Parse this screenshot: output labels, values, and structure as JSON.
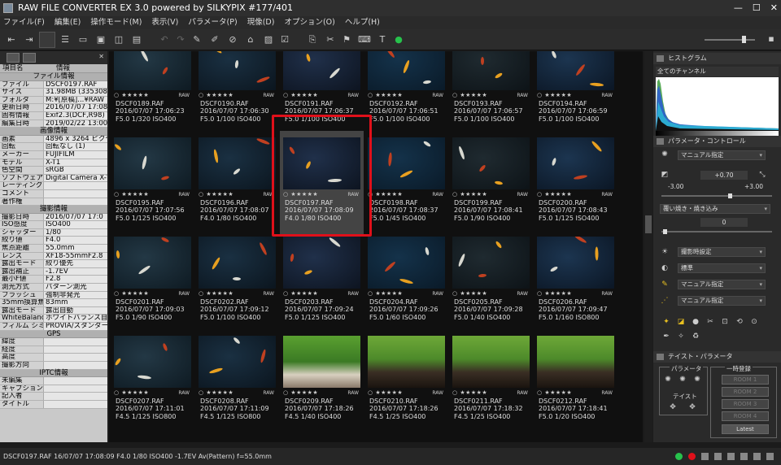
{
  "window": {
    "title": "RAW FILE CONVERTER EX 3.0 powered by SILKYPIX    #177/401"
  },
  "menu": [
    "ファイル(F)",
    "編集(E)",
    "操作モード(M)",
    "表示(V)",
    "パラメータ(P)",
    "現像(D)",
    "オプション(O)",
    "ヘルプ(H)"
  ],
  "left_panel": {
    "header": {
      "key": "項目名",
      "value": "情報"
    },
    "rows": [
      {
        "type": "section",
        "label": "ファイル情報"
      },
      {
        "k": "ファイル",
        "v": "DSCF0197.RAF"
      },
      {
        "k": "サイズ",
        "v": "31.98MB (3353088"
      },
      {
        "k": "フォルダ",
        "v": "M:¥[原稿]...¥RAW"
      },
      {
        "k": "更新日時",
        "v": "2016/07/07 17:08:"
      },
      {
        "k": "固有情報",
        "v": "Exif2.3(DCF,R98) Y"
      },
      {
        "k": "編集日時",
        "v": "2019/02/22 13:00:"
      },
      {
        "type": "section",
        "label": "画像情報"
      },
      {
        "k": "画素",
        "v": "4896 x 3264 ピクセル"
      },
      {
        "k": "回転",
        "v": "回転なし (1)"
      },
      {
        "k": "メーカー",
        "v": "FUJIFILM"
      },
      {
        "k": "モデル",
        "v": "X-T1"
      },
      {
        "k": "色空間",
        "v": "sRGB"
      },
      {
        "k": "ソフトウェア",
        "v": "Digital Camera X-T"
      },
      {
        "k": "レーティング",
        "v": ""
      },
      {
        "k": "コメント",
        "v": ""
      },
      {
        "k": "著作権",
        "v": ""
      },
      {
        "type": "section",
        "label": "撮影情報"
      },
      {
        "k": "撮影日時",
        "v": "2016/07/07 17:0"
      },
      {
        "k": "ISO感度",
        "v": "ISO400"
      },
      {
        "k": "シャッター",
        "v": "1/80"
      },
      {
        "k": "絞り値",
        "v": "F4.0"
      },
      {
        "k": "焦点距離",
        "v": "55.0mm"
      },
      {
        "k": "レンズ",
        "v": "XF18-55mmF2.8"
      },
      {
        "k": "露出モード",
        "v": "絞り優先"
      },
      {
        "k": "露出補正",
        "v": "-1.7EV"
      },
      {
        "k": "最小F値",
        "v": "F2.8"
      },
      {
        "k": "測光方式",
        "v": "パターン測光"
      },
      {
        "k": "フラッシュ",
        "v": "強制非発光"
      },
      {
        "k": "35mm換算焦点",
        "v": "83mm"
      },
      {
        "k": "露出モード",
        "v": "露出自動"
      },
      {
        "k": "WhiteBalance",
        "v": "ホワイトバランス自動"
      },
      {
        "k": "フィルム シミュ",
        "v": "PROVIA/スタンダード"
      },
      {
        "type": "section",
        "label": "GPS"
      },
      {
        "k": "緯度",
        "v": ""
      },
      {
        "k": "経度",
        "v": ""
      },
      {
        "k": "高度",
        "v": ""
      },
      {
        "k": "撮影方向",
        "v": ""
      },
      {
        "type": "section",
        "label": "IPTC情報"
      },
      {
        "k": "未編集",
        "v": ""
      },
      {
        "k": "キャプション",
        "v": ""
      },
      {
        "k": "記入者",
        "v": ""
      },
      {
        "k": "タイトル",
        "v": ""
      }
    ]
  },
  "thumbnails": [
    {
      "name": "DSCF0189.RAF",
      "date": "2016/07/07 17:06:23",
      "exp": "F5.0 1/320 ISO400"
    },
    {
      "name": "DSCF0190.RAF",
      "date": "2016/07/07 17:06:30",
      "exp": "F5.0 1/100 ISO400"
    },
    {
      "name": "DSCF0191.RAF",
      "date": "2016/07/07 17:06:37",
      "exp": "F5.0 1/100 ISO400"
    },
    {
      "name": "DSCF0192.RAF",
      "date": "2016/07/07 17:06:51",
      "exp": "F5.0 1/100 ISO400"
    },
    {
      "name": "DSCF0193.RAF",
      "date": "2016/07/07 17:06:57",
      "exp": "F5.0 1/100 ISO400"
    },
    {
      "name": "DSCF0194.RAF",
      "date": "2016/07/07 17:06:59",
      "exp": "F5.0 1/100 ISO400"
    },
    {
      "name": "DSCF0195.RAF",
      "date": "2016/07/07 17:07:56",
      "exp": "F5.0 1/125 ISO400"
    },
    {
      "name": "DSCF0196.RAF",
      "date": "2016/07/07 17:08:07",
      "exp": "F4.0 1/80 ISO400"
    },
    {
      "name": "DSCF0197.RAF",
      "date": "2016/07/07 17:08:09",
      "exp": "F4.0 1/80 ISO400"
    },
    {
      "name": "DSCF0198.RAF",
      "date": "2016/07/07 17:08:37",
      "exp": "F5.0 1/45 ISO400"
    },
    {
      "name": "DSCF0199.RAF",
      "date": "2016/07/07 17:08:41",
      "exp": "F5.0 1/90 ISO400"
    },
    {
      "name": "DSCF0200.RAF",
      "date": "2016/07/07 17:08:43",
      "exp": "F5.0 1/125 ISO400"
    },
    {
      "name": "DSCF0201.RAF",
      "date": "2016/07/07 17:09:03",
      "exp": "F5.0 1/90 ISO400"
    },
    {
      "name": "DSCF0202.RAF",
      "date": "2016/07/07 17:09:12",
      "exp": "F5.0 1/100 ISO400"
    },
    {
      "name": "DSCF0203.RAF",
      "date": "2016/07/07 17:09:24",
      "exp": "F5.0 1/125 ISO400"
    },
    {
      "name": "DSCF0204.RAF",
      "date": "2016/07/07 17:09:26",
      "exp": "F5.0 1/60 ISO400"
    },
    {
      "name": "DSCF0205.RAF",
      "date": "2016/07/07 17:09:28",
      "exp": "F5.0 1/40 ISO400"
    },
    {
      "name": "DSCF0206.RAF",
      "date": "2016/07/07 17:09:47",
      "exp": "F5.0 1/160 ISO800"
    },
    {
      "name": "DSCF0207.RAF",
      "date": "2016/07/07 17:11:01",
      "exp": "F4.5 1/125 ISO800"
    },
    {
      "name": "DSCF0208.RAF",
      "date": "2016/07/07 17:11:09",
      "exp": "F4.5 1/125 ISO800"
    },
    {
      "name": "DSCF0209.RAF",
      "date": "2016/07/07 17:18:26",
      "exp": "F4.5 1/40 ISO400"
    },
    {
      "name": "DSCF0210.RAF",
      "date": "2016/07/07 17:18:26",
      "exp": "F4.5 1/25 ISO400"
    },
    {
      "name": "DSCF0211.RAF",
      "date": "2016/07/07 17:18:32",
      "exp": "F4.5 1/25 ISO400"
    },
    {
      "name": "DSCF0212.RAF",
      "date": "2016/07/07 17:18:41",
      "exp": "F5.0 1/20 ISO400"
    }
  ],
  "selected_index": 8,
  "right_panel": {
    "histogram_title": "ヒストグラム",
    "channel": "全てのチャンネル",
    "param_title": "パラメータ・コントロール",
    "wb": "マニュアル指定",
    "exposure_value": "+0.70",
    "exposure_min": "-3.00",
    "exposure_max": "+3.00",
    "fill_light_label": "覆い焼き・焼き込み",
    "fill_light_value": "0",
    "scene": "撮影時設定",
    "tone": "標準",
    "sharp": "マニュアル指定",
    "color": "マニュアル指定",
    "taste_title": "テイスト・パラメータ",
    "param_group": "パラメータ",
    "taste_group": "テイスト",
    "temp_group": "一時登録",
    "rooms": [
      "ROOM 1",
      "ROOM 2",
      "ROOM 3",
      "ROOM 4"
    ],
    "latest": "Latest"
  },
  "status": "DSCF0197.RAF 16/07/07 17:08:09 F4.0 1/80 ISO400 -1.7EV Av(Pattern) f=55.0mm",
  "colors": {
    "selection": "#e0101a",
    "accent": "#27c24c"
  }
}
